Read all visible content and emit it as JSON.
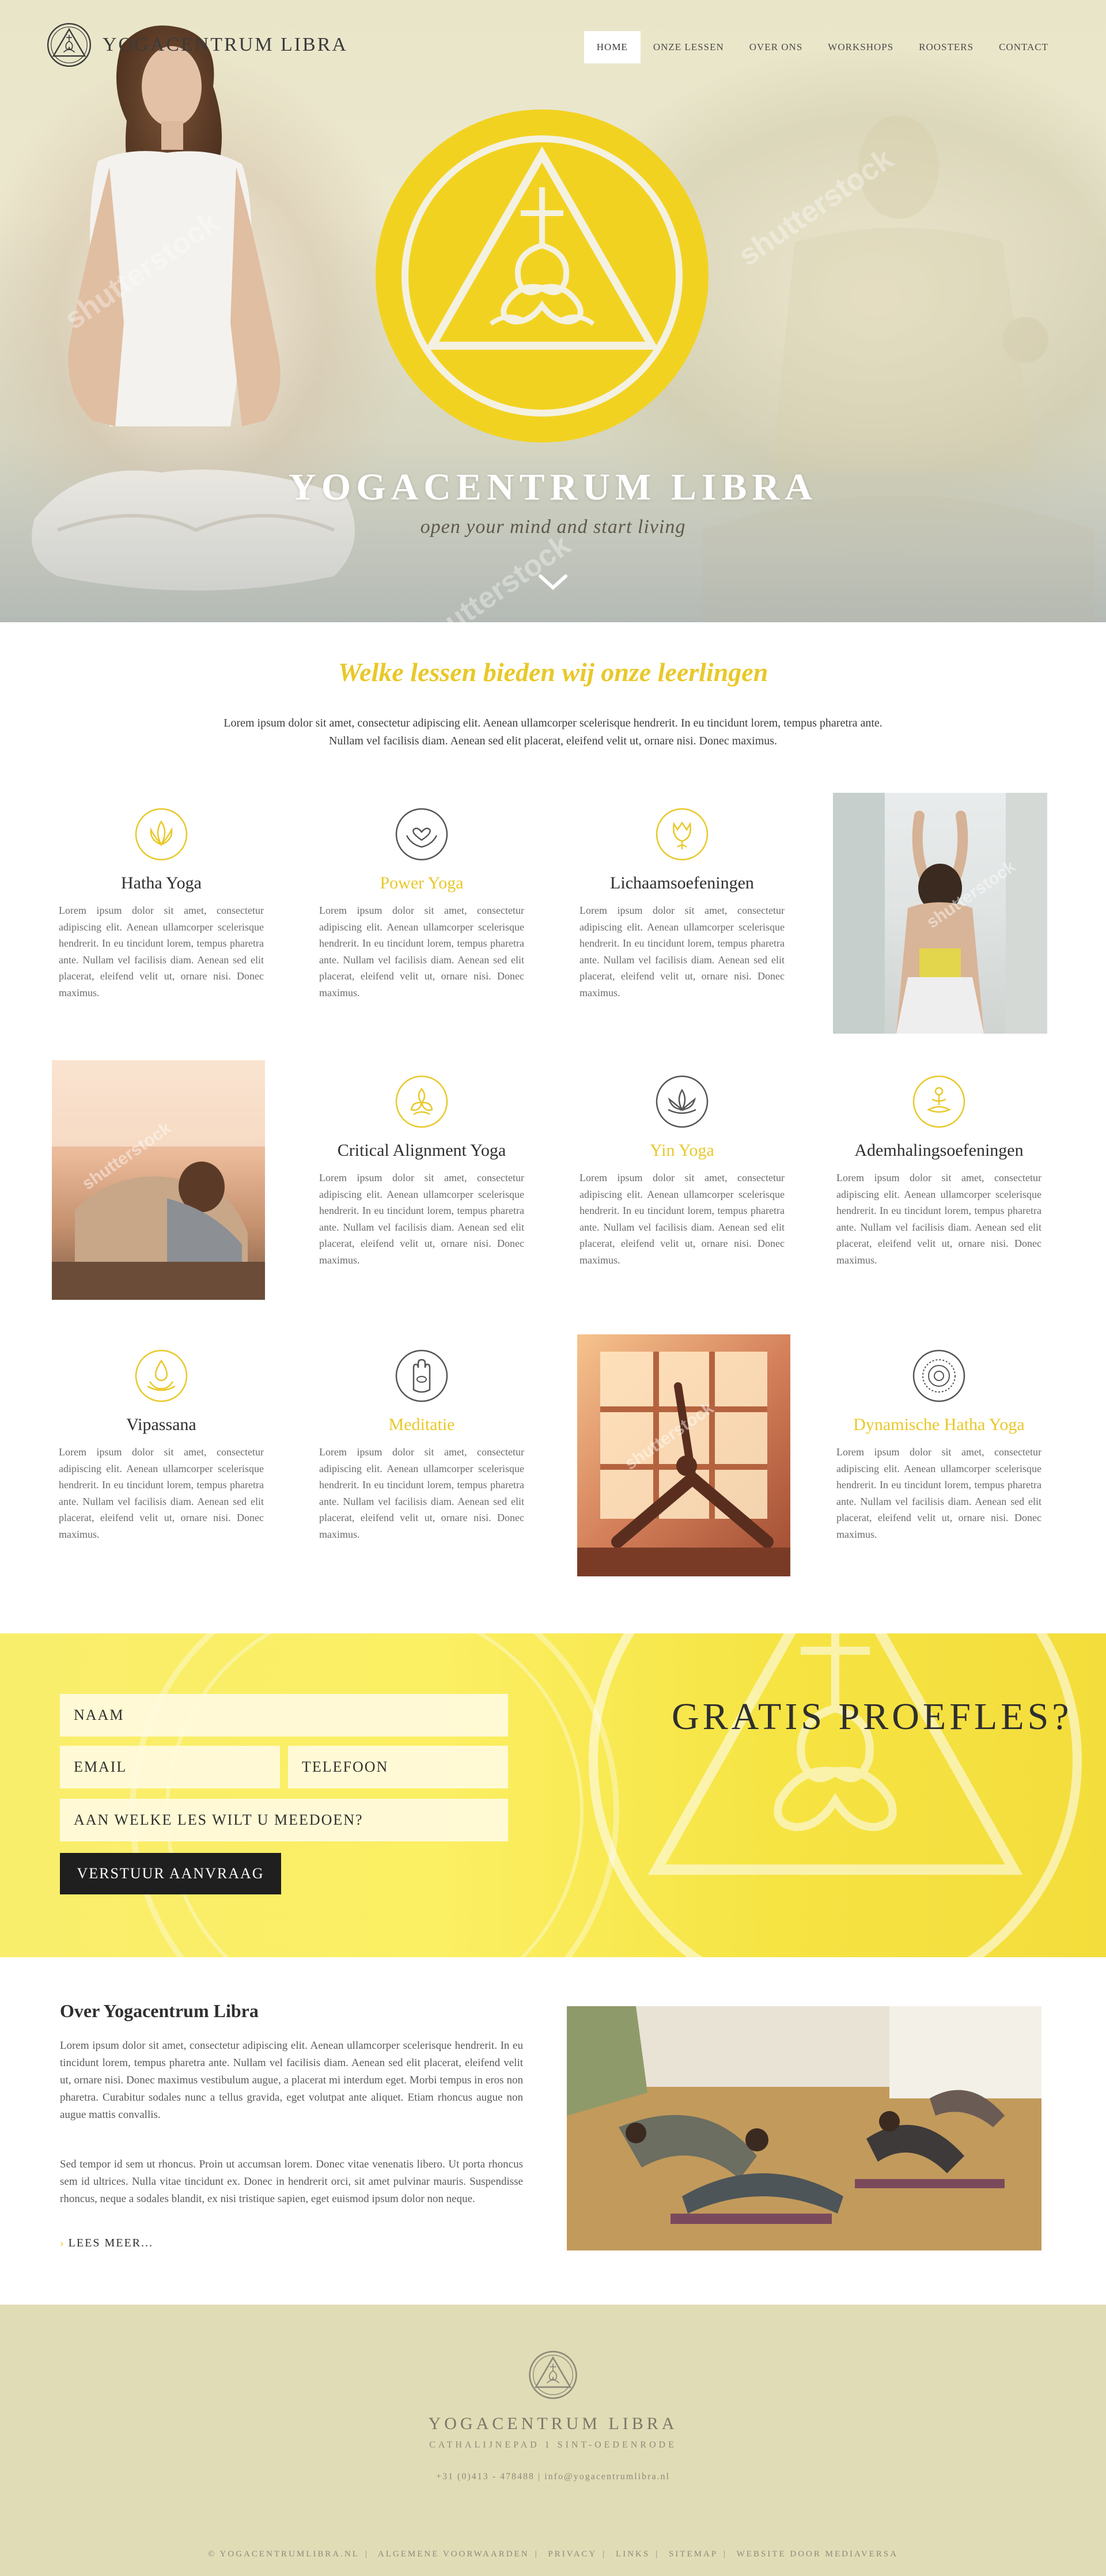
{
  "brand": {
    "name": "YOGACENTRUM LIBRA",
    "hero_title": "YOGACENTRUM LIBRA",
    "tagline": "open your mind and start living",
    "watermark": "shutterstock"
  },
  "nav": {
    "items": [
      {
        "label": "HOME",
        "active": true
      },
      {
        "label": "ONZE LESSEN",
        "active": false
      },
      {
        "label": "OVER ONS",
        "active": false
      },
      {
        "label": "WORKSHOPS",
        "active": false
      },
      {
        "label": "ROOSTERS",
        "active": false
      },
      {
        "label": "CONTACT",
        "active": false
      }
    ]
  },
  "lessons": {
    "title": "Welke lessen bieden wij onze leerlingen",
    "intro": "Lorem ipsum dolor sit amet, consectetur adipiscing elit. Aenean ullamcorper scelerisque hendrerit. In eu tincidunt lorem, tempus pharetra ante. Nullam vel facilisis diam. Aenean sed elit placerat, eleifend velit ut, ornare nisi. Donec maximus.",
    "items": [
      {
        "name": "Hatha Yoga",
        "icon": "lotus-icon",
        "desc": "Lorem ipsum dolor sit amet, consectetur adipiscing elit. Aenean ullamcorper scelerisque hendrerit. In eu tincidunt lorem, tempus pharetra ante. Nullam vel facilisis diam. Aenean sed elit placerat, eleifend velit ut, ornare nisi. Donec maximus."
      },
      {
        "name": "Power Yoga",
        "icon": "hands-heart-icon",
        "desc": "Lorem ipsum dolor sit amet, consectetur adipiscing elit. Aenean ullamcorper scelerisque hendrerit. In eu tincidunt lorem, tempus pharetra ante. Nullam vel facilisis diam. Aenean sed elit placerat, eleifend velit ut, ornare nisi. Donec maximus."
      },
      {
        "name": "Lichaamsoefeningen",
        "icon": "tulip-icon",
        "desc": "Lorem ipsum dolor sit amet, consectetur adipiscing elit. Aenean ullamcorper scelerisque hendrerit. In eu tincidunt lorem, tempus pharetra ante. Nullam vel facilisis diam. Aenean sed elit placerat, eleifend velit ut, ornare nisi. Donec maximus."
      },
      {
        "name": "Critical Alignment Yoga",
        "icon": "triple-leaf-icon",
        "desc": "Lorem ipsum dolor sit amet, consectetur adipiscing elit. Aenean ullamcorper scelerisque hendrerit. In eu tincidunt lorem, tempus pharetra ante. Nullam vel facilisis diam. Aenean sed elit placerat, eleifend velit ut, ornare nisi. Donec maximus."
      },
      {
        "name": "Yin Yoga",
        "icon": "lotus-outline-icon",
        "desc": "Lorem ipsum dolor sit amet, consectetur adipiscing elit. Aenean ullamcorper scelerisque hendrerit. In eu tincidunt lorem, tempus pharetra ante. Nullam vel facilisis diam. Aenean sed elit placerat, eleifend velit ut, ornare nisi. Donec maximus."
      },
      {
        "name": "Ademhalingsoefeningen",
        "icon": "meditation-figure-icon",
        "desc": "Lorem ipsum dolor sit amet, consectetur adipiscing elit. Aenean ullamcorper scelerisque hendrerit. In eu tincidunt lorem, tempus pharetra ante. Nullam vel facilisis diam. Aenean sed elit placerat, eleifend velit ut, ornare nisi. Donec maximus."
      },
      {
        "name": "Vipassana",
        "icon": "drop-lotus-icon",
        "desc": "Lorem ipsum dolor sit amet, consectetur adipiscing elit. Aenean ullamcorper scelerisque hendrerit. In eu tincidunt lorem, tempus pharetra ante. Nullam vel facilisis diam. Aenean sed elit placerat, eleifend velit ut, ornare nisi. Donec maximus."
      },
      {
        "name": "Meditatie",
        "icon": "hamsa-hand-icon",
        "desc": "Lorem ipsum dolor sit amet, consectetur adipiscing elit. Aenean ullamcorper scelerisque hendrerit. In eu tincidunt lorem, tempus pharetra ante. Nullam vel facilisis diam. Aenean sed elit placerat, eleifend velit ut, ornare nisi. Donec maximus."
      },
      {
        "name": "Dynamische Hatha Yoga",
        "icon": "mandala-icon",
        "desc": "Lorem ipsum dolor sit amet, consectetur adipiscing elit. Aenean ullamcorper scelerisque hendrerit. In eu tincidunt lorem, tempus pharetra ante. Nullam vel facilisis diam. Aenean sed elit placerat, eleifend velit ut, ornare nisi. Donec maximus."
      }
    ]
  },
  "form": {
    "name_placeholder": "NAAM",
    "email_placeholder": "EMAIL",
    "phone_placeholder": "TELEFOON",
    "lesson_placeholder": "AAN WELKE LES WILT U MEEDOEN?",
    "submit_label": "VERSTUUR AANVRAAG",
    "title": "GRATIS PROEFLES?"
  },
  "about": {
    "title": "Over Yogacentrum Libra",
    "p1": "Lorem ipsum dolor sit amet, consectetur adipiscing elit. Aenean ullamcorper scelerisque hendrerit. In eu tincidunt lorem, tempus pharetra ante. Nullam vel facilisis diam. Aenean sed elit placerat, eleifend velit ut, ornare nisi. Donec maximus vestibulum augue, a placerat mi interdum eget. Morbi tempus in eros non pharetra. Curabitur sodales nunc a tellus gravida, eget volutpat ante aliquet. Etiam rhoncus augue non augue mattis convallis.",
    "p2": "Sed tempor id sem ut rhoncus. Proin ut accumsan lorem. Donec vitae venenatis libero. Ut porta rhoncus sem id ultrices. Nulla vitae tincidunt ex. Donec in hendrerit orci, sit amet pulvinar mauris. Suspendisse rhoncus, neque a sodales blandit, ex nisi tristique sapien, eget euismod ipsum dolor non neque.",
    "more": "LEES MEER..."
  },
  "footer": {
    "name": "YOGACENTRUM LIBRA",
    "address": "CATHALIJNEPAD 1 SINT-OEDENRODE",
    "phone": "+31 (0)413 - 478488",
    "email": "info@yogacentrumlibra.nl",
    "links": [
      "© YOGACENTRUMLIBRA.NL",
      "ALGEMENE VOORWAARDEN",
      "PRIVACY",
      "LINKS",
      "SITEMAP",
      "WEBSITE DOOR MEDIAVERSA"
    ]
  },
  "colors": {
    "accent": "#e9c82a",
    "emblem_yellow": "#f2d221",
    "footer_bg": "#e0dcb6",
    "button_dark": "#1f1f1f"
  }
}
